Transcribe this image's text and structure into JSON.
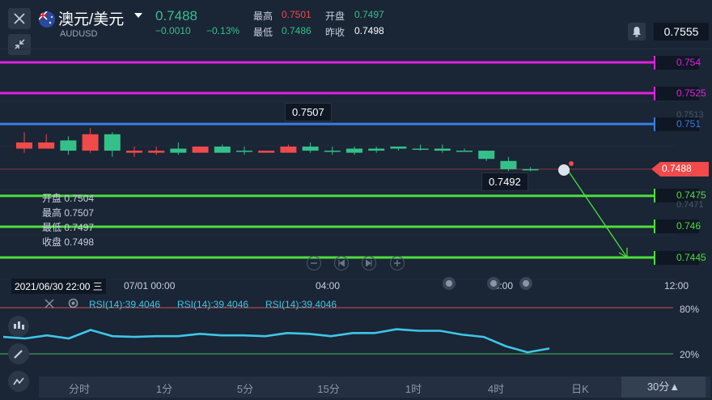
{
  "header": {
    "title": "澳元/美元",
    "symbol": "AUDUSD",
    "price": "0.7488",
    "change": "−0.0010",
    "change_pct": "−0.13%",
    "high_label": "最高",
    "high": "0.7501",
    "open_label": "开盘",
    "open": "0.7497",
    "low_label": "最低",
    "low": "0.7486",
    "prevclose_label": "昨收",
    "prevclose": "0.7498",
    "alert_price": "0.7555"
  },
  "chart_data": {
    "type": "candlestick",
    "symbol": "AUDUSD",
    "candles": [
      {
        "o": 0.7501,
        "h": 0.7506,
        "l": 0.7496,
        "c": 0.7498
      },
      {
        "o": 0.7501,
        "h": 0.7505,
        "l": 0.7498,
        "c": 0.7498
      },
      {
        "o": 0.7497,
        "h": 0.7504,
        "l": 0.7495,
        "c": 0.7502
      },
      {
        "o": 0.7505,
        "h": 0.7508,
        "l": 0.7496,
        "c": 0.7497
      },
      {
        "o": 0.7497,
        "h": 0.7506,
        "l": 0.7494,
        "c": 0.7505
      },
      {
        "o": 0.7497,
        "h": 0.7499,
        "l": 0.7494,
        "c": 0.7496
      },
      {
        "o": 0.7497,
        "h": 0.7499,
        "l": 0.7495,
        "c": 0.7496
      },
      {
        "o": 0.7496,
        "h": 0.7501,
        "l": 0.7495,
        "c": 0.7498
      },
      {
        "o": 0.7499,
        "h": 0.7499,
        "l": 0.7496,
        "c": 0.7496
      },
      {
        "o": 0.7496,
        "h": 0.75,
        "l": 0.7496,
        "c": 0.7499
      },
      {
        "o": 0.7497,
        "h": 0.7499,
        "l": 0.7495,
        "c": 0.7497
      },
      {
        "o": 0.7497,
        "h": 0.7497,
        "l": 0.7496,
        "c": 0.7496
      },
      {
        "o": 0.7499,
        "h": 0.75,
        "l": 0.7496,
        "c": 0.7496
      },
      {
        "o": 0.7497,
        "h": 0.7501,
        "l": 0.7496,
        "c": 0.7499
      },
      {
        "o": 0.7497,
        "h": 0.7499,
        "l": 0.7495,
        "c": 0.7497
      },
      {
        "o": 0.7496,
        "h": 0.7499,
        "l": 0.7495,
        "c": 0.7498
      },
      {
        "o": 0.7497,
        "h": 0.7499,
        "l": 0.7496,
        "c": 0.7498
      },
      {
        "o": 0.7498,
        "h": 0.7499,
        "l": 0.7497,
        "c": 0.7499
      },
      {
        "o": 0.7498,
        "h": 0.75,
        "l": 0.7497,
        "c": 0.7498
      },
      {
        "o": 0.7497,
        "h": 0.75,
        "l": 0.7496,
        "c": 0.7498
      },
      {
        "o": 0.7497,
        "h": 0.7498,
        "l": 0.7497,
        "c": 0.7497
      },
      {
        "o": 0.7493,
        "h": 0.7497,
        "l": 0.7492,
        "c": 0.7497
      },
      {
        "o": 0.7488,
        "h": 0.7494,
        "l": 0.7487,
        "c": 0.7492
      },
      {
        "o": 0.7488,
        "h": 0.7489,
        "l": 0.7487,
        "c": 0.7488
      }
    ],
    "hlines": [
      {
        "value": 0.754,
        "label": "0.754",
        "color": "#e020e0"
      },
      {
        "value": 0.7525,
        "label": "0.7525",
        "color": "#e020e0"
      },
      {
        "value": 0.751,
        "label": "0.751",
        "color": "#3a7de0"
      },
      {
        "value": 0.7475,
        "label": "0.7475",
        "color": "#4cde3c"
      },
      {
        "value": 0.746,
        "label": "0.746",
        "color": "#4cde3c"
      },
      {
        "value": 0.7445,
        "label": "0.7445",
        "color": "#4cde3c"
      }
    ],
    "current_price": {
      "value": 0.7488,
      "label": "0.7488",
      "color": "#f04a4a"
    },
    "callouts": [
      {
        "label": "0.7507"
      },
      {
        "label": "0.7492"
      }
    ],
    "faded_axis_labels": [
      "0.7513",
      "0.7471"
    ],
    "ylim": [
      0.744,
      0.756
    ],
    "rsi": {
      "label": "RSI(14):39.4046",
      "upper": "80%",
      "lower": "20%",
      "values": [
        42,
        40,
        44,
        40,
        51,
        43,
        42,
        43,
        43,
        46,
        44,
        44,
        43,
        47,
        46,
        43,
        47,
        47,
        52,
        50,
        50,
        45,
        42,
        30,
        22,
        27
      ],
      "color": "#3ec6e8"
    },
    "time_labels": [
      "2021/06/30 22:00 三",
      "07/01 00:00",
      "04:00",
      "08:00",
      "12:00"
    ]
  },
  "ohlc_panel": {
    "open": "开盘 0.7504",
    "high": "最高 0.7507",
    "low": "最低 0.7497",
    "close": "收盘 0.7498"
  },
  "tabs": [
    "分时",
    "1分",
    "5分",
    "15分",
    "1时",
    "4时",
    "日K",
    "30分▲"
  ],
  "colors": {
    "up": "#35c08a",
    "down": "#f04a4a",
    "bg": "#1a2535"
  }
}
